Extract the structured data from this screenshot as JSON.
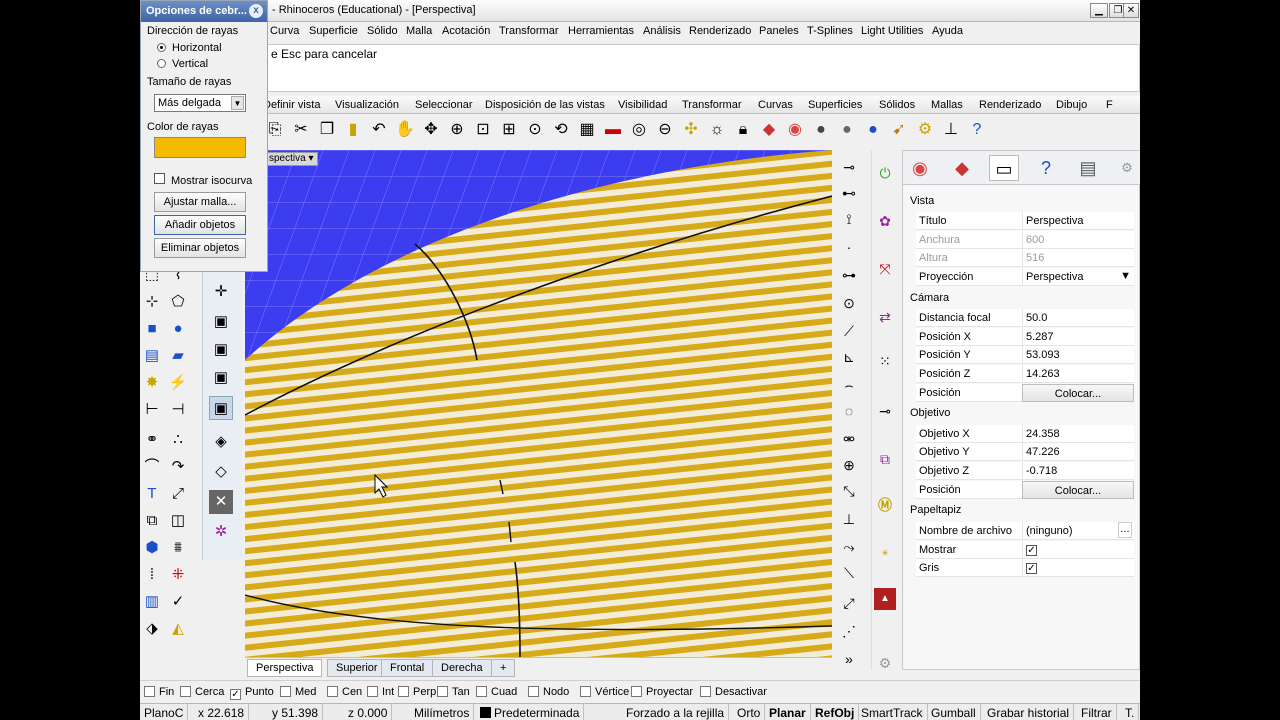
{
  "window": {
    "title": "- Rhinoceros (Educational) - [Perspectiva]",
    "minimize": "▁",
    "restore": "❐",
    "close": "✕"
  },
  "menu": [
    "Curva",
    "Superficie",
    "Sólido",
    "Malla",
    "Acotación",
    "Transformar",
    "Herramientas",
    "Análisis",
    "Renderizado",
    "Paneles",
    "T-Splines",
    "Light Utilities",
    "Ayuda"
  ],
  "command": {
    "prompt": "e Esc para cancelar"
  },
  "toolbar_tabs": [
    "Definir vista",
    "Visualización",
    "Seleccionar",
    "Disposición de las vistas",
    "Visibilidad",
    "Transformar",
    "Curvas",
    "Superficies",
    "Sólidos",
    "Mallas",
    "Renderizado",
    "Dibujo",
    "F"
  ],
  "viewport": {
    "label": "spectiva",
    "tabs": [
      "Perspectiva",
      "Superior",
      "Frontal",
      "Derecha"
    ],
    "add_tab": "+",
    "stripe_color": "#d6aa18"
  },
  "zebra": {
    "title": "Opciones de cebr...",
    "close": "x",
    "direction_label": "Dirección de rayas",
    "horizontal": "Horizontal",
    "vertical": "Vertical",
    "size_label": "Tamaño de rayas",
    "size_value": "Más delgada",
    "color_label": "Color de rayas",
    "color": "#f4ba00",
    "isocurve": "Mostrar isocurva",
    "adjust_mesh": "Ajustar malla...",
    "add_objects": "Añadir objetos",
    "remove_objects": "Eliminar objetos"
  },
  "props": {
    "vista": "Vista",
    "titulo_k": "Título",
    "titulo_v": "Perspectiva",
    "anchura_k": "Anchura",
    "anchura_v": "600",
    "altura_k": "Altura",
    "altura_v": "516",
    "proyeccion_k": "Proyección",
    "proyeccion_v": "Perspectiva",
    "camara": "Cámara",
    "focal_k": "Distancia focal",
    "focal_v": "50.0",
    "px_k": "Posición X",
    "px_v": "5.287",
    "py_k": "Posición Y",
    "py_v": "53.093",
    "pz_k": "Posición Z",
    "pz_v": "14.263",
    "pos_k": "Posición",
    "pos_btn": "Colocar...",
    "objetivo": "Objetivo",
    "ox_k": "Objetivo X",
    "ox_v": "24.358",
    "oy_k": "Objetivo Y",
    "oy_v": "47.226",
    "oz_k": "Objetivo Z",
    "oz_v": "-0.718",
    "opos_k": "Posición",
    "opos_btn": "Colocar...",
    "papel": "Papeltapiz",
    "file_k": "Nombre de archivo",
    "file_v": "(ninguno)",
    "file_btn": "...",
    "mostrar_k": "Mostrar",
    "gris_k": "Gris"
  },
  "osnaps": [
    {
      "label": "Fin",
      "checked": false
    },
    {
      "label": "Cerca",
      "checked": false
    },
    {
      "label": "Punto",
      "checked": true
    },
    {
      "label": "Med",
      "checked": false
    },
    {
      "label": "Cen",
      "checked": false
    },
    {
      "label": "Int",
      "checked": false
    },
    {
      "label": "Perp",
      "checked": false
    },
    {
      "label": "Tan",
      "checked": false
    },
    {
      "label": "Cuad",
      "checked": false
    },
    {
      "label": "Nodo",
      "checked": false
    },
    {
      "label": "Vértice",
      "checked": false
    },
    {
      "label": "Proyectar",
      "checked": false
    },
    {
      "label": "Desactivar",
      "checked": false
    }
  ],
  "status": {
    "plane": "PlanoC",
    "x": "x 22.618",
    "y": "y 51.398",
    "z": "z 0.000",
    "units": "Milímetros",
    "layer": "Predeterminada",
    "grid_snap": "Forzado a la rejilla",
    "ortho": "Orto",
    "planar": "Planar",
    "refobj": "RefObj",
    "smarttrack": "SmartTrack",
    "gumball": "Gumball",
    "history": "Grabar historial",
    "filter": "Filtrar",
    "t": "T."
  }
}
